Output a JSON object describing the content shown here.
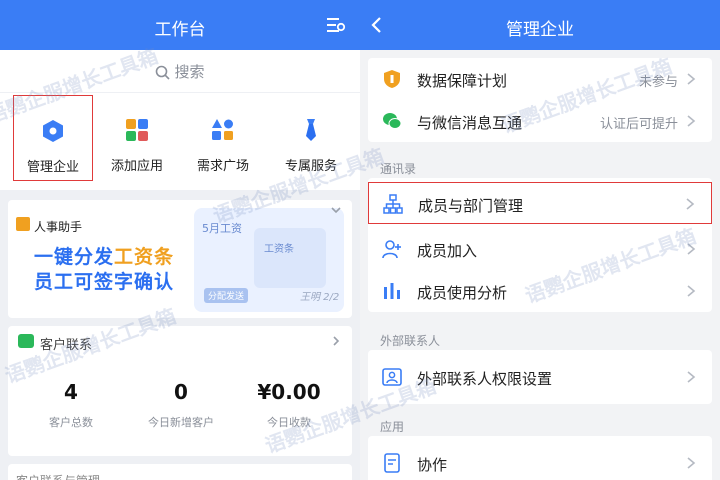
{
  "left": {
    "title": "工作台",
    "search_placeholder": "搜索",
    "apps": [
      {
        "label": "管理企业"
      },
      {
        "label": "添加应用"
      },
      {
        "label": "需求广场"
      },
      {
        "label": "专属服务"
      }
    ],
    "banner": {
      "tag": "人事助手",
      "line1_a": "一键分发",
      "line1_b": "工资条",
      "line2": "员工可签字确认",
      "month": "5月工资",
      "card_title": "工资条",
      "pill": "分配发送",
      "signature": "王明 2/2"
    },
    "customers": {
      "header": "客户联系",
      "stats": [
        {
          "value": "4",
          "label": "客户总数"
        },
        {
          "value": "0",
          "label": "今日新增客户"
        },
        {
          "value": "¥0.00",
          "label": "今日收款"
        }
      ]
    },
    "bottom_text": "客户联系与管理"
  },
  "right": {
    "title": "管理企业",
    "top_rows": [
      {
        "label": "数据保障计划",
        "value": "未参与"
      },
      {
        "label": "与微信消息互通",
        "value": "认证后可提升"
      }
    ],
    "section_contacts": "通讯录",
    "contact_rows": [
      {
        "label": "成员与部门管理"
      },
      {
        "label": "成员加入"
      },
      {
        "label": "成员使用分析"
      }
    ],
    "section_external": "外部联系人",
    "external_rows": [
      {
        "label": "外部联系人权限设置"
      }
    ],
    "section_apps": "应用",
    "app_rows": [
      {
        "label": "协作"
      }
    ]
  },
  "watermark": "语鹦企服增长工具箱",
  "colors": {
    "primary": "#3a7df5",
    "highlight_border": "#e03a3a",
    "accent_orange": "#f0a020",
    "wechat_green": "#2bb85a"
  }
}
